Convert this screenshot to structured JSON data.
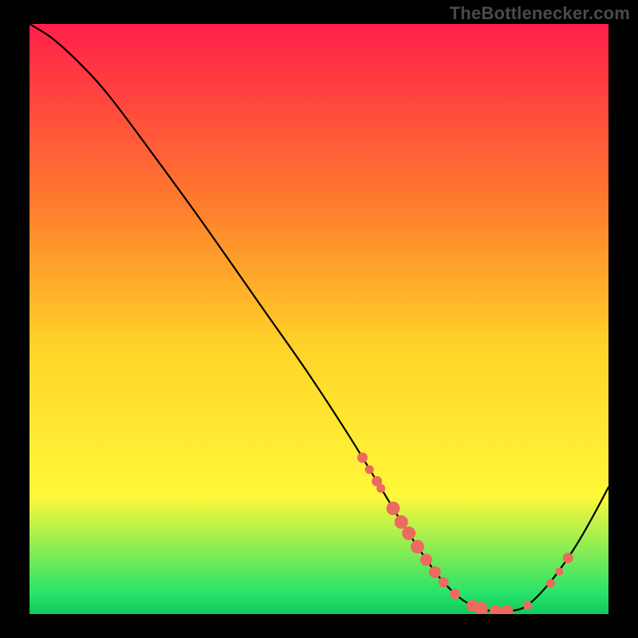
{
  "watermark": "TheBottlenecker.com",
  "colors": {
    "black": "#000000",
    "curve": "#000000",
    "dots": "#ec6a5e",
    "grad_top": "#ff1f4a",
    "grad_mid_upper": "#ff7a2e",
    "grad_mid": "#ffd427",
    "grad_mid_lower": "#fff83a",
    "grad_bottom": "#27e36a",
    "grad_bottom2": "#10c95a"
  },
  "chart_data": {
    "type": "line",
    "title": "",
    "xlabel": "",
    "ylabel": "",
    "xlim": [
      0,
      100
    ],
    "ylim": [
      0,
      100
    ],
    "curve": [
      {
        "x": 0,
        "y": 100
      },
      {
        "x": 4,
        "y": 97.5
      },
      {
        "x": 9,
        "y": 93
      },
      {
        "x": 14,
        "y": 87.5
      },
      {
        "x": 22,
        "y": 77
      },
      {
        "x": 30,
        "y": 66.2
      },
      {
        "x": 40,
        "y": 52.2
      },
      {
        "x": 48,
        "y": 41
      },
      {
        "x": 55,
        "y": 30.5
      },
      {
        "x": 60,
        "y": 22.5
      },
      {
        "x": 64,
        "y": 16
      },
      {
        "x": 68,
        "y": 10
      },
      {
        "x": 71,
        "y": 6
      },
      {
        "x": 74,
        "y": 3
      },
      {
        "x": 77,
        "y": 1.2
      },
      {
        "x": 80,
        "y": 0.5
      },
      {
        "x": 83,
        "y": 0.5
      },
      {
        "x": 86,
        "y": 1.5
      },
      {
        "x": 90,
        "y": 5.5
      },
      {
        "x": 94,
        "y": 11
      },
      {
        "x": 97,
        "y": 16
      },
      {
        "x": 100,
        "y": 21.5
      }
    ],
    "dots": [
      {
        "x": 57.5,
        "y": 26.5,
        "r": 1.3
      },
      {
        "x": 58.7,
        "y": 24.5,
        "r": 1.1
      },
      {
        "x": 60.0,
        "y": 22.5,
        "r": 1.3
      },
      {
        "x": 60.7,
        "y": 21.3,
        "r": 1.1
      },
      {
        "x": 62.8,
        "y": 17.9,
        "r": 1.7
      },
      {
        "x": 64.2,
        "y": 15.6,
        "r": 1.7
      },
      {
        "x": 65.5,
        "y": 13.7,
        "r": 1.7
      },
      {
        "x": 67.0,
        "y": 11.4,
        "r": 1.7
      },
      {
        "x": 68.5,
        "y": 9.2,
        "r": 1.5
      },
      {
        "x": 70.0,
        "y": 7.1,
        "r": 1.5
      },
      {
        "x": 71.5,
        "y": 5.4,
        "r": 1.3
      },
      {
        "x": 73.5,
        "y": 3.4,
        "r": 1.3
      },
      {
        "x": 76.5,
        "y": 1.4,
        "r": 1.5
      },
      {
        "x": 78.0,
        "y": 0.9,
        "r": 1.7
      },
      {
        "x": 80.5,
        "y": 0.5,
        "r": 1.5
      },
      {
        "x": 82.5,
        "y": 0.5,
        "r": 1.5
      },
      {
        "x": 86.0,
        "y": 1.5,
        "r": 1.1
      },
      {
        "x": 90.0,
        "y": 5.2,
        "r": 1.1
      },
      {
        "x": 91.5,
        "y": 7.2,
        "r": 1.0
      },
      {
        "x": 93.0,
        "y": 9.5,
        "r": 1.3
      }
    ],
    "background_gradient_stops": [
      {
        "offset": 0.0,
        "key": "grad_top"
      },
      {
        "offset": 0.3,
        "key": "grad_mid_upper"
      },
      {
        "offset": 0.55,
        "key": "grad_mid"
      },
      {
        "offset": 0.8,
        "key": "grad_mid_lower"
      },
      {
        "offset": 0.965,
        "key": "grad_bottom"
      },
      {
        "offset": 1.0,
        "key": "grad_bottom2"
      }
    ]
  }
}
